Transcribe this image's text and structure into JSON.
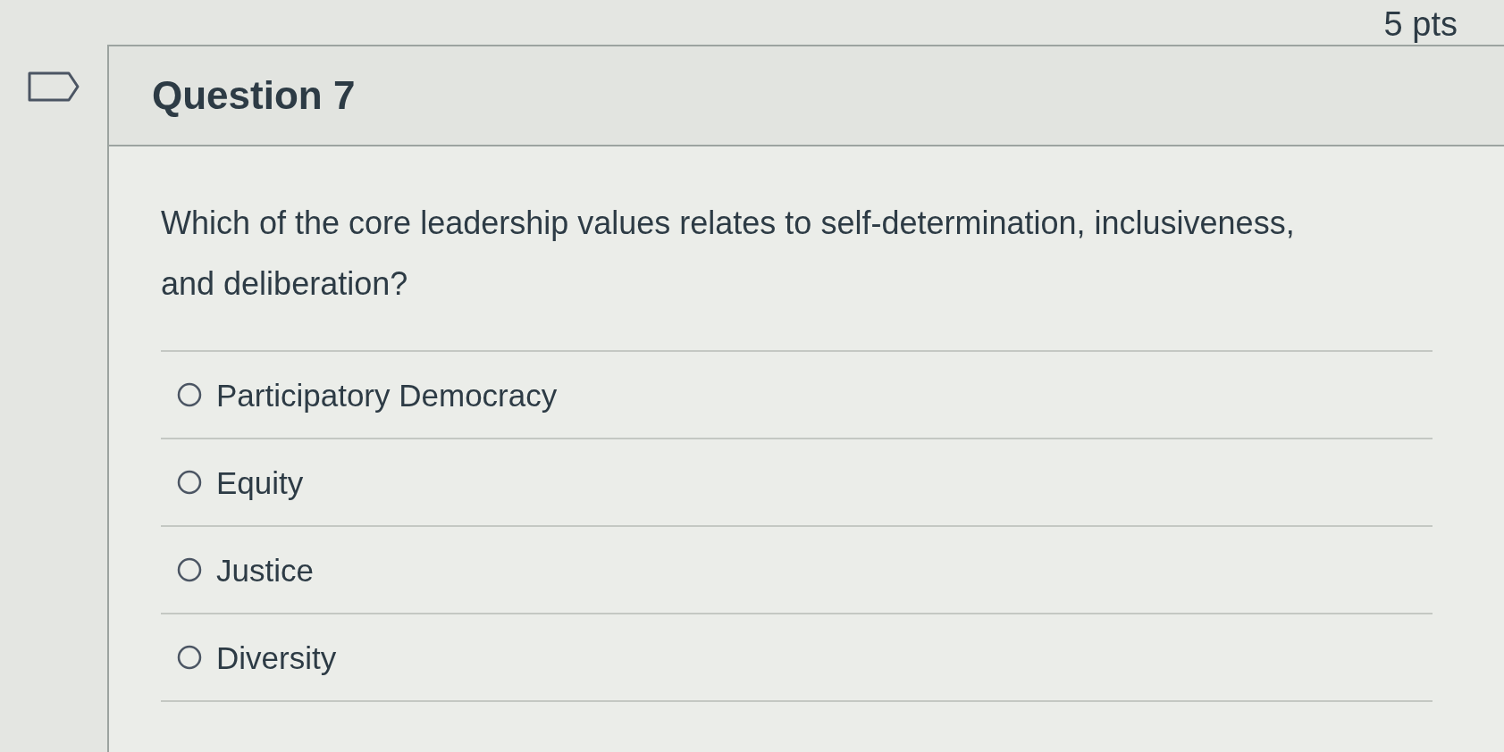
{
  "question": {
    "flagged": false,
    "title": "Question 7",
    "points": "5 pts",
    "text": "Which of the core leadership values relates to self-determination, inclusiveness, and deliberation?",
    "answers": [
      {
        "label": "Participatory Democracy",
        "selected": false
      },
      {
        "label": "Equity",
        "selected": false
      },
      {
        "label": "Justice",
        "selected": false
      },
      {
        "label": "Diversity",
        "selected": false
      }
    ]
  }
}
